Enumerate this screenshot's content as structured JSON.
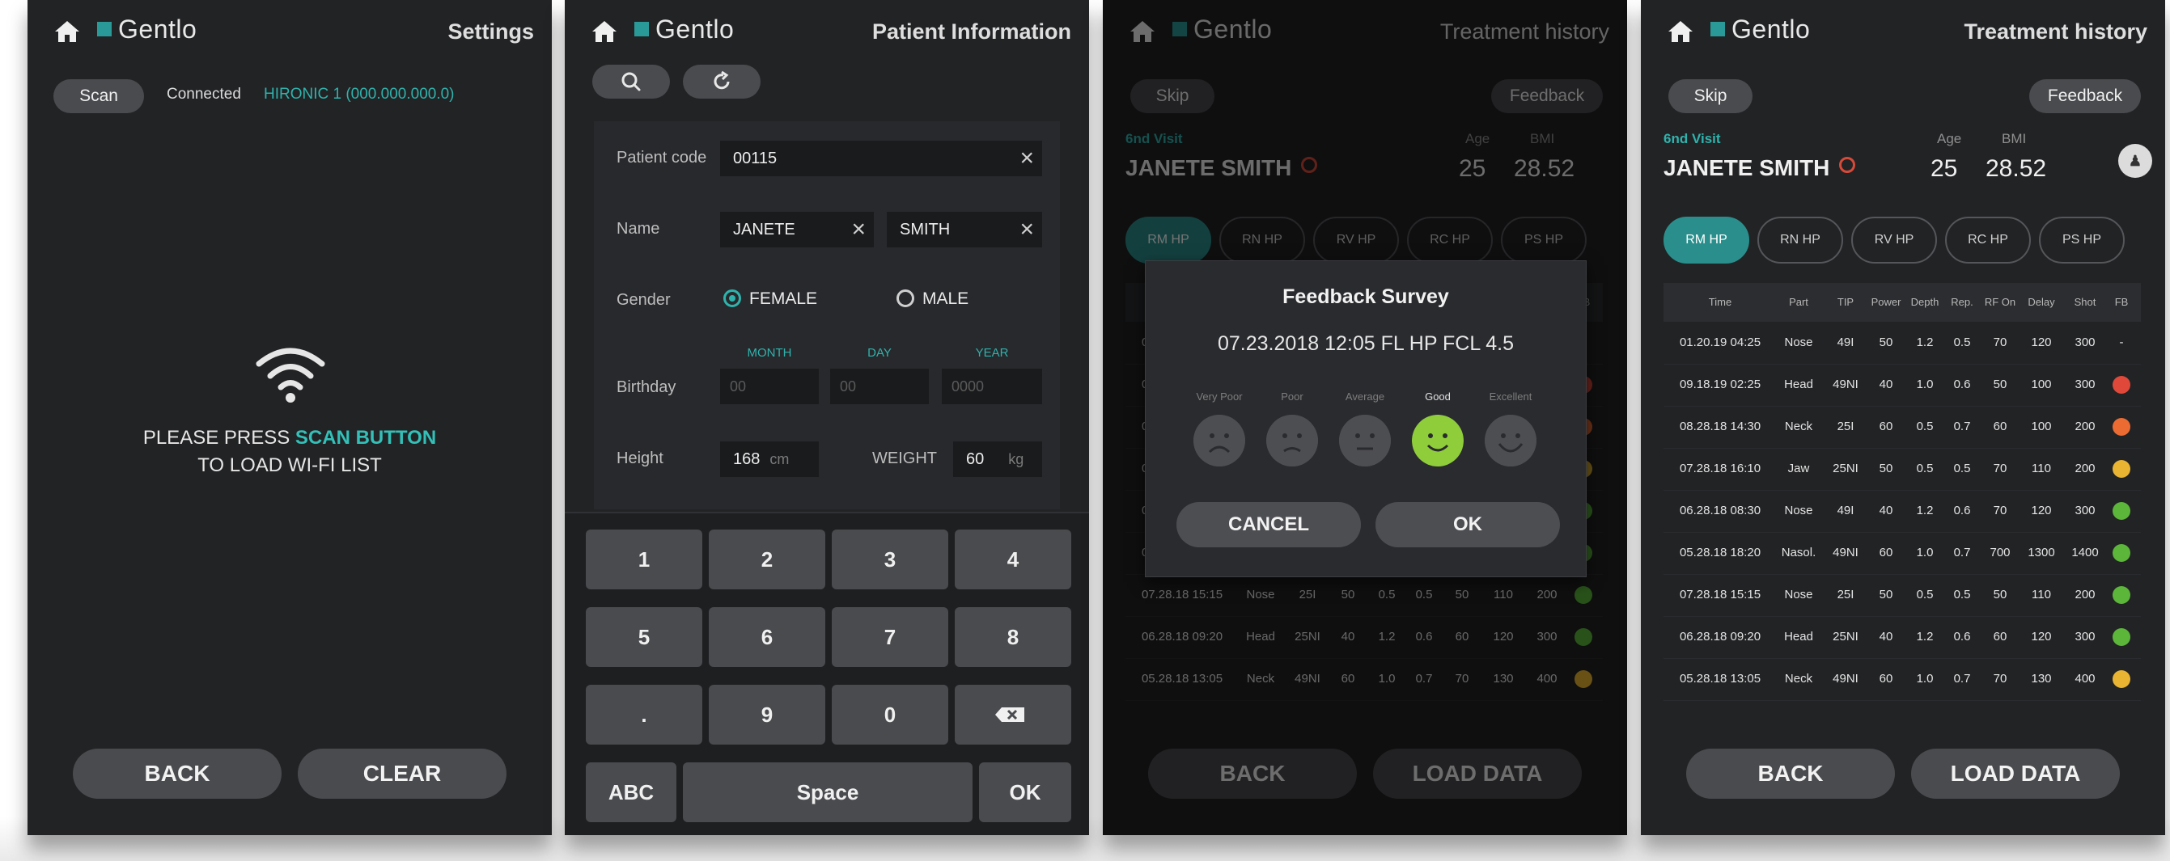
{
  "app": {
    "logo": "Gentlo"
  },
  "screen1": {
    "title": "Settings",
    "scan_label": "Scan",
    "status": "Connected",
    "device": "HIRONIC 1 (000.000.000.0)",
    "msg_line1_a": "PLEASE PRESS ",
    "msg_line1_b": "SCAN BUTTON",
    "msg_line2": "TO LOAD WI-FI LIST",
    "back": "BACK",
    "clear": "CLEAR"
  },
  "screen2": {
    "title": "Patient Information",
    "patient_code_label": "Patient code",
    "patient_code": "00115",
    "name_label": "Name",
    "first_name": "JANETE",
    "last_name": "SMITH",
    "gender_label": "Gender",
    "female": "FEMALE",
    "male": "MALE",
    "selected_gender": "FEMALE",
    "birthday_label": "Birthday",
    "month_label": "MONTH",
    "day_label": "DAY",
    "year_label": "YEAR",
    "month_ph": "00",
    "day_ph": "00",
    "year_ph": "0000",
    "height_label": "Height",
    "height": "168",
    "height_unit": "cm",
    "weight_label": "WEIGHT",
    "weight": "60",
    "weight_unit": "kg",
    "keys": [
      "1",
      "2",
      "3",
      "4",
      "5",
      "6",
      "7",
      "8",
      ".",
      "9",
      "0"
    ],
    "key_abc": "ABC",
    "key_space": "Space",
    "key_ok": "OK"
  },
  "treatment": {
    "title": "Treatment history",
    "skip": "Skip",
    "feedback": "Feedback",
    "visit": "6nd Visit",
    "patient": "JANETE SMITH",
    "age_label": "Age",
    "bmi_label": "BMI",
    "age": "25",
    "bmi": "28.52",
    "tabs": [
      "RM HP",
      "RN HP",
      "RV HP",
      "RC HP",
      "PS HP"
    ],
    "active_tab": "RM HP",
    "columns": [
      "Time",
      "Part",
      "TIP",
      "Power",
      "Depth",
      "Rep.",
      "RF On",
      "Delay",
      "Shot",
      "FB"
    ],
    "rows": [
      [
        "01.20.19 04:25",
        "Nose",
        "49I",
        "50",
        "1.2",
        "0.5",
        "70",
        "120",
        "300",
        "-"
      ],
      [
        "09.18.19 02:25",
        "Head",
        "49NI",
        "40",
        "1.0",
        "0.6",
        "50",
        "100",
        "300",
        ""
      ],
      [
        "08.28.18 14:30",
        "Neck",
        "25I",
        "60",
        "0.5",
        "0.7",
        "60",
        "100",
        "200",
        ""
      ],
      [
        "07.28.18 16:10",
        "Jaw",
        "25NI",
        "50",
        "0.5",
        "0.5",
        "70",
        "110",
        "200",
        ""
      ],
      [
        "06.28.18 08:30",
        "Nose",
        "49I",
        "40",
        "1.2",
        "0.6",
        "70",
        "120",
        "300",
        ""
      ],
      [
        "05.28.18 18:20",
        "Nasol.",
        "49NI",
        "60",
        "1.0",
        "0.7",
        "700",
        "1300",
        "1400",
        ""
      ],
      [
        "07.28.18 15:15",
        "Nose",
        "25I",
        "50",
        "0.5",
        "0.5",
        "50",
        "110",
        "200",
        ""
      ],
      [
        "06.28.18 09:20",
        "Head",
        "25NI",
        "40",
        "1.2",
        "0.6",
        "60",
        "120",
        "300",
        ""
      ],
      [
        "05.28.18 13:05",
        "Neck",
        "49NI",
        "60",
        "1.0",
        "0.7",
        "70",
        "130",
        "400",
        ""
      ]
    ],
    "row_fb": [
      "none",
      "red",
      "orange",
      "yellow",
      "green",
      "green",
      "green",
      "green",
      "yellow"
    ],
    "back": "BACK",
    "load": "LOAD DATA"
  },
  "survey": {
    "title": "Feedback Survey",
    "subtitle": "07.23.2018  12:05  FL HP  FCL 4.5",
    "ratings": [
      "Very Poor",
      "Poor",
      "Average",
      "Good",
      "Excellent"
    ],
    "selected": "Good",
    "cancel": "CANCEL",
    "ok": "OK"
  },
  "colors": {
    "accent": "#2fb3ad",
    "screen_bg": "#222325",
    "button": "#4a4b4e",
    "red": "#e0483a",
    "orange": "#ec6b32",
    "yellow": "#e9b432",
    "green": "#5cb63a"
  },
  "icons": [
    "home-icon",
    "search-icon",
    "refresh-icon",
    "wifi-icon",
    "backspace-icon",
    "pin-icon",
    "avatar-icon",
    "close-icon"
  ]
}
